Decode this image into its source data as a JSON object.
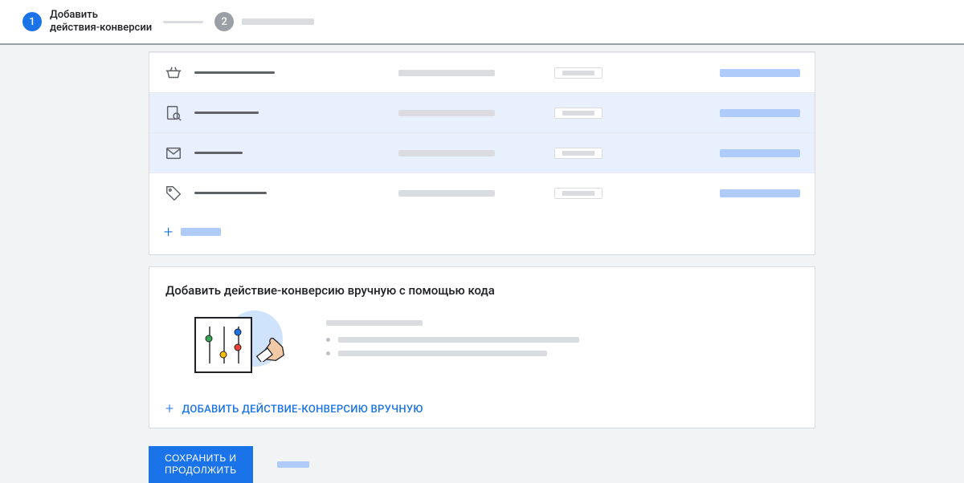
{
  "stepper": {
    "step1": {
      "num": "1",
      "label": "Добавить\nдействия-конверсии"
    },
    "step2": {
      "num": "2"
    }
  },
  "rows": [
    {
      "icon": "basket-icon",
      "selected": false
    },
    {
      "icon": "search-page-icon",
      "selected": true
    },
    {
      "icon": "mail-icon",
      "selected": true
    },
    {
      "icon": "tag-icon",
      "selected": false
    }
  ],
  "manual": {
    "heading": "Добавить действие-конверсию вручную с помощью кода",
    "add_button": "ДОБАВИТЬ ДЕЙСТВИЕ-КОНВЕРСИЮ ВРУЧНУЮ"
  },
  "footer": {
    "primary": "СОХРАНИТЬ И\nПРОДОЛЖИТЬ"
  },
  "icons": {
    "basket": "basket",
    "search_page": "search-page",
    "mail": "mail",
    "tag": "tag"
  }
}
